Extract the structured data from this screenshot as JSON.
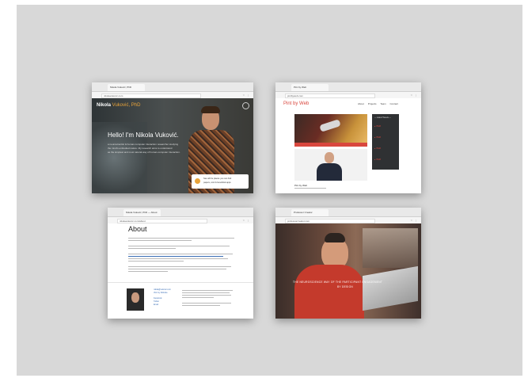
{
  "windows": [
    {
      "tab": "Nikola Vuković, PhD",
      "url": "nikolavukovic.com",
      "brand_name": "Nikola",
      "brand_rest": " Vuković, PhD",
      "hero_title": "Hello! I'm Nikola Vuković.",
      "hero_line1": "a neuroscientist & human computer interaction researcher studying",
      "hero_line2": "the mind's embodied nature. My research aims to understand",
      "hero_line3": "as the simplest and most natural way of human-computer interaction.",
      "card_line1": "See all the places you can find",
      "card_line2": "papers, cool & beneficial apps"
    },
    {
      "tab": "Pint by Web",
      "url": "pintbyweb.com",
      "logo": "Pint by Web",
      "nav": [
        "About",
        "Projects",
        "Team",
        "Contact"
      ],
      "person_caption": "Pint by Web",
      "sidebar_title": "— Latest Tweets —",
      "sidebar_items": [
        "● ITEM",
        "● ITEM",
        "● ITEM",
        "● ITEM"
      ]
    },
    {
      "tab": "Nikola Vuković, PhD — About",
      "url": "nikolavukovic.com/about",
      "heading": "About",
      "contact_links": [
        "nikola@vukovic.com",
        "Visit my Website",
        "Facebook",
        "Twitter",
        "Email"
      ]
    },
    {
      "tab": "Professor Creator",
      "url": "professorcreator.com",
      "overlay_line1": "THE NEUROSCIENCE WAY OF THE PARTICIPANT ENGAGEMENT",
      "overlay_line2": "BY DESIGN"
    }
  ],
  "colors": {
    "canvas": "#d8d8d8",
    "accent_red": "#d9473e",
    "brand_orange": "#e8a33a",
    "link_blue": "#3b6fb6"
  }
}
